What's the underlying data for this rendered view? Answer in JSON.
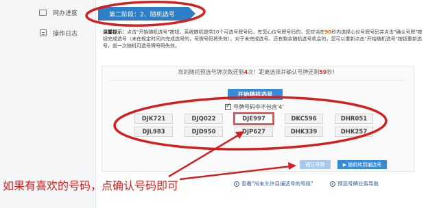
{
  "sidebar": {
    "items": [
      {
        "label": "网办进度",
        "icon": "desktop-icon"
      },
      {
        "label": "操作日志",
        "icon": "log-icon"
      }
    ]
  },
  "stage_tab": {
    "label": "第二阶段：2、随机选号"
  },
  "notice": {
    "prefix": "温馨提示：",
    "line1a": "点击\"开始随机选号\"按钮，系统随机提供10个可选号牌号码，有您心仪号牌号码的，您应当在",
    "time": "90",
    "line1b": "秒内选择心仪号牌号码并点击\"确认号牌\"按钮完成选号（未在规定时间内完成选号的，号牌号码将失效）。对于未完成选号、还有剩余随机选号机会的，您可以重新点击\"开始随机选号\"按钮重新选号，前一次随机可选号牌号码失效。"
  },
  "countdown": {
    "part1": "您的随机预选号牌次数还剩",
    "remaining": "4",
    "part2": "次！距离选择并确认号牌还剩",
    "seconds": "59",
    "part3": "秒！"
  },
  "start_button": {
    "label": "开始随机选号"
  },
  "exclude_option": {
    "label": "号牌号码中不包含'4'",
    "checked": true
  },
  "plates": [
    {
      "number": "DJK721"
    },
    {
      "number": "DJQ022"
    },
    {
      "number": "DJE997",
      "selected": true
    },
    {
      "number": "DKC596"
    },
    {
      "number": "DHR051"
    },
    {
      "number": "DJL983"
    },
    {
      "number": "DJD950"
    },
    {
      "number": "DJP627"
    },
    {
      "number": "DHK339"
    },
    {
      "number": "DHK257"
    }
  ],
  "actions": {
    "confirm_label": "确认号牌",
    "next_label": "▶ 随机转到编选号"
  },
  "links": {
    "link1": "查看\"尚未允许自编选号的号段\"",
    "link2": "预选号牌业务导航"
  },
  "annotation": "如果有喜欢的号码，点确认号码即可",
  "colors": {
    "accent_blue": "#2f7fc8",
    "annotation_red": "#d21f1f",
    "highlight_orange": "#e0661c"
  }
}
